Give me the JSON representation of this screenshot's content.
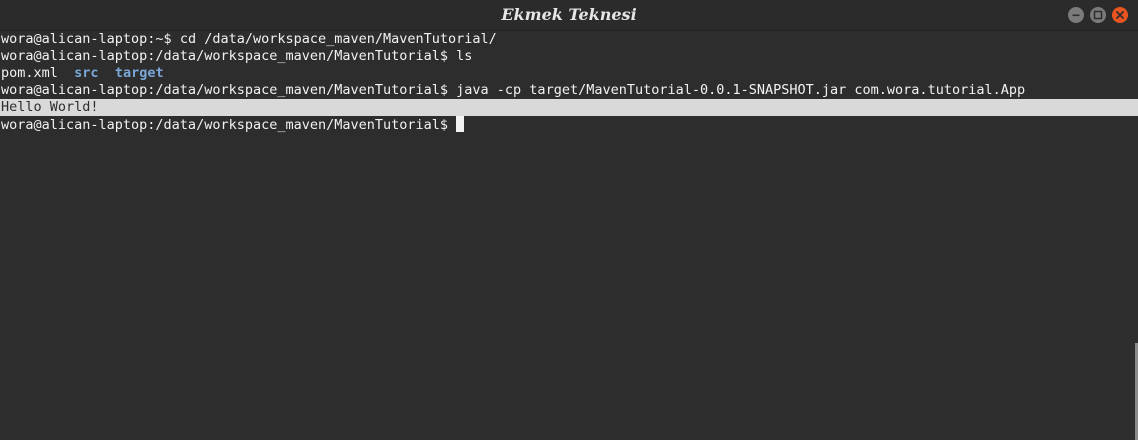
{
  "window": {
    "title": "Ekmek Teknesi"
  },
  "terminal": {
    "lines": [
      {
        "prompt": "wora@alican-laptop:~$",
        "command": " cd /data/workspace_maven/MavenTutorial/"
      },
      {
        "prompt": "wora@alican-laptop:/data/workspace_maven/MavenTutorial$",
        "command": " ls"
      },
      {
        "file": "pom.xml",
        "dir1": "src",
        "dir2": "target"
      },
      {
        "prompt": "wora@alican-laptop:/data/workspace_maven/MavenTutorial$",
        "command": " java -cp target/MavenTutorial-0.0.1-SNAPSHOT.jar com.wora.tutorial.App"
      },
      {
        "output": "Hello World!"
      },
      {
        "prompt": "wora@alican-laptop:/data/workspace_maven/MavenTutorial$",
        "command": " "
      }
    ]
  },
  "colors": {
    "background": "#2d2d2d",
    "text": "#f2f2f2",
    "directory": "#7aa7d8",
    "close_button": "#e95420"
  },
  "icons": {
    "minimize": "minimize-icon",
    "maximize": "maximize-icon",
    "close": "close-icon"
  }
}
